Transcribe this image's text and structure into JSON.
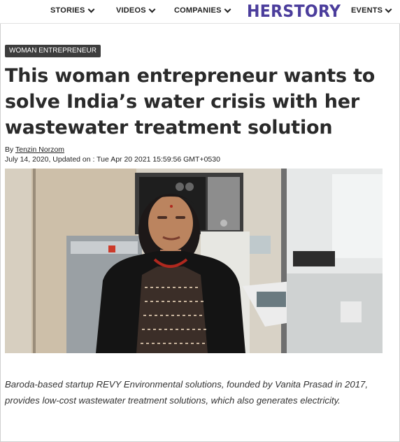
{
  "nav": {
    "items": [
      {
        "label": "STORIES"
      },
      {
        "label": "VIDEOS"
      },
      {
        "label": "COMPANIES"
      },
      {
        "label": "EVENTS"
      }
    ],
    "logo": "HERSTORY"
  },
  "article": {
    "category": "WOMAN ENTREPRENEUR",
    "headline": "This woman entrepreneur wants to solve India’s water crisis with her wastewater treatment solution",
    "by_prefix": "By",
    "author": "Tenzin Norzom",
    "dateline": "July 14, 2020, Updated on : Tue Apr 20 2021 15:59:56 GMT+0530",
    "caption": "Baroda-based startup REVY Environmental solutions, founded by Vanita Prasad in 2017, provides low-cost wastewater treatment solutions, which also generates electricity."
  },
  "colors": {
    "logo": "#4b3d9c",
    "badge_bg": "#3d3d3d"
  },
  "icons": [
    "chevron-down-icon"
  ]
}
